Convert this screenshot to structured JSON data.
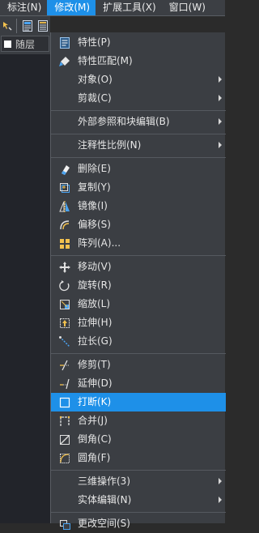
{
  "menubar": {
    "items": [
      {
        "label": "标注(N)"
      },
      {
        "label": "修改(M)"
      },
      {
        "label": "扩展工具(X)"
      },
      {
        "label": "窗口(W)"
      }
    ]
  },
  "toolbar": {
    "layer_combo_value": "随层"
  },
  "dropdown": {
    "items": [
      {
        "label": "特性(P)",
        "icon": "properties-icon"
      },
      {
        "label": "特性匹配(M)",
        "icon": "match-properties-icon"
      },
      {
        "label": "对象(O)",
        "submenu": true
      },
      {
        "label": "剪裁(C)",
        "submenu": true
      },
      {
        "label": "外部参照和块编辑(B)",
        "submenu": true
      },
      {
        "label": "注释性比例(N)",
        "submenu": true
      },
      {
        "label": "删除(E)",
        "icon": "erase-icon"
      },
      {
        "label": "复制(Y)",
        "icon": "copy-icon"
      },
      {
        "label": "镜像(I)",
        "icon": "mirror-icon"
      },
      {
        "label": "偏移(S)",
        "icon": "offset-icon"
      },
      {
        "label": "阵列(A)...",
        "icon": "array-icon"
      },
      {
        "label": "移动(V)",
        "icon": "move-icon"
      },
      {
        "label": "旋转(R)",
        "icon": "rotate-icon"
      },
      {
        "label": "缩放(L)",
        "icon": "scale-icon"
      },
      {
        "label": "拉伸(H)",
        "icon": "stretch-icon"
      },
      {
        "label": "拉长(G)",
        "icon": "lengthen-icon"
      },
      {
        "label": "修剪(T)",
        "icon": "trim-icon"
      },
      {
        "label": "延伸(D)",
        "icon": "extend-icon"
      },
      {
        "label": "打断(K)",
        "icon": "break-icon",
        "highlighted": true
      },
      {
        "label": "合并(J)",
        "icon": "join-icon"
      },
      {
        "label": "倒角(C)",
        "icon": "chamfer-icon"
      },
      {
        "label": "圆角(F)",
        "icon": "fillet-icon"
      },
      {
        "label": "三维操作(3)",
        "submenu": true
      },
      {
        "label": "实体编辑(N)",
        "submenu": true
      },
      {
        "label": "更改空间(S)",
        "icon": "change-space-icon"
      }
    ]
  },
  "colors": {
    "accent": "#1e90e8",
    "menu_bg": "#3b3e43"
  }
}
